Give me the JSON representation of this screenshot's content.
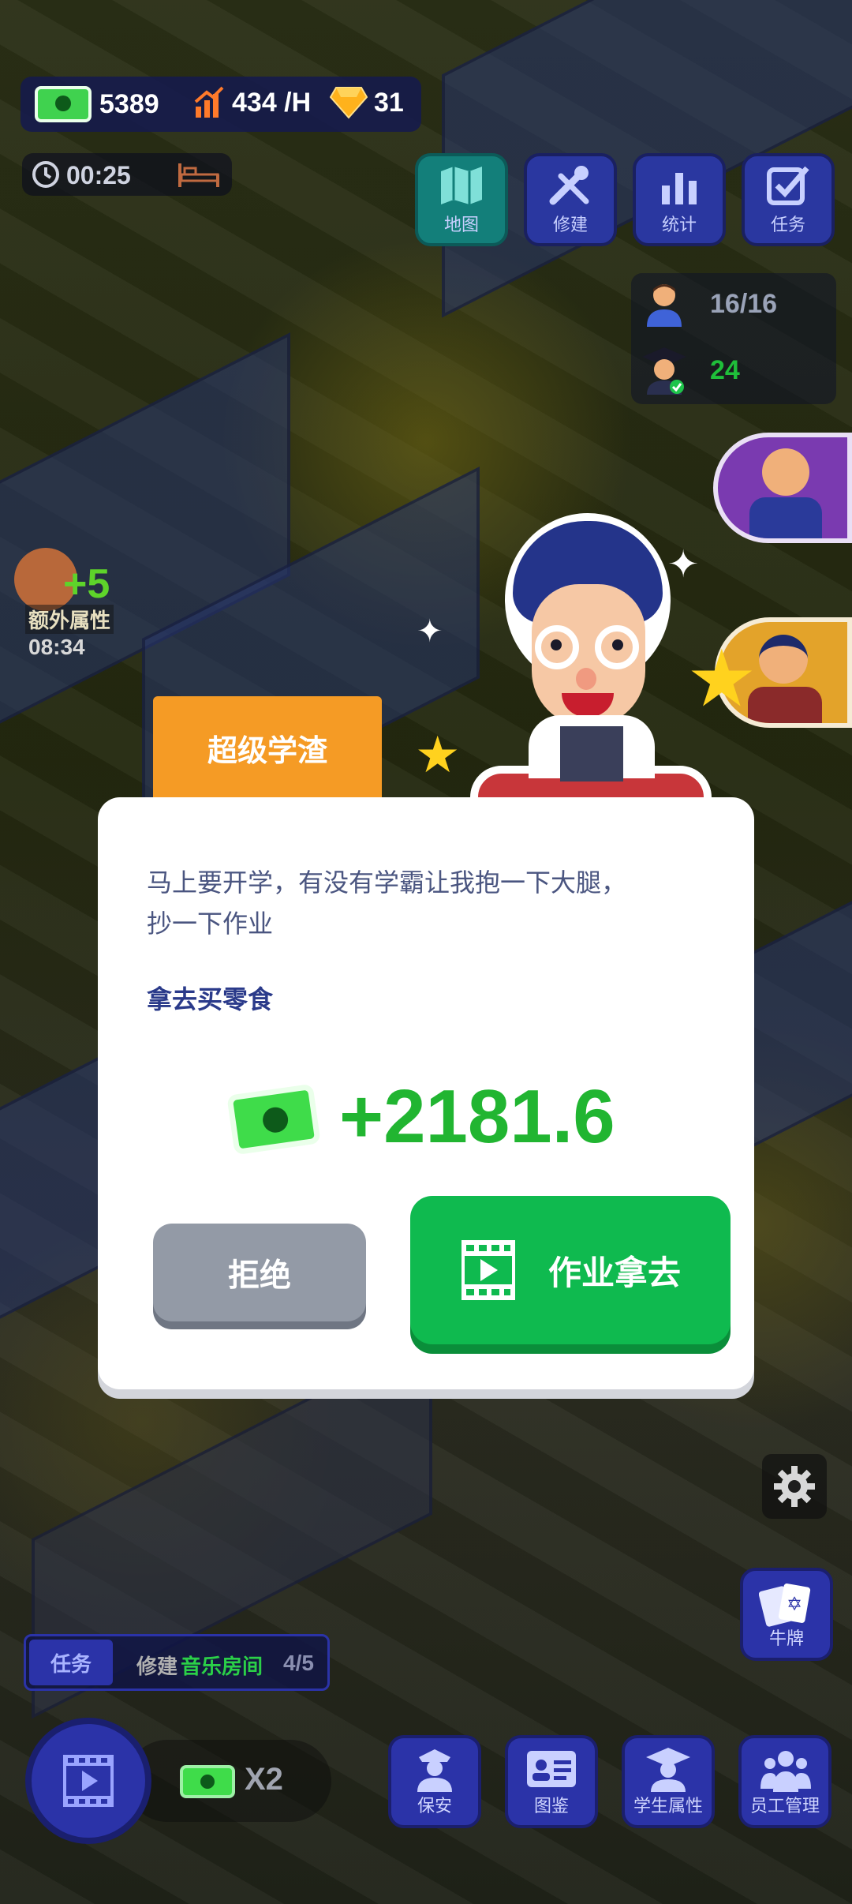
{
  "currency": {
    "cash": "5389",
    "income": "434 /H",
    "gems": "31"
  },
  "timer": "00:25",
  "top_menu": [
    {
      "label": "地图",
      "icon": "map-icon"
    },
    {
      "label": "修建",
      "icon": "tools-icon"
    },
    {
      "label": "统计",
      "icon": "bar-chart-icon"
    },
    {
      "label": "任务",
      "icon": "checkbox-icon"
    }
  ],
  "population": {
    "students": "16/16",
    "graduates": "24"
  },
  "bonus": {
    "value": "+5",
    "label": "额外属性",
    "timer": "08:34"
  },
  "dialog": {
    "title": "超级学渣",
    "message_line1": "马上要开学，有没有学霸让我抱一下大腿，",
    "message_line2": "抄一下作业",
    "action_text": "拿去买零食",
    "reward": "+2181.6",
    "reject_label": "拒绝",
    "accept_label": "作业拿去"
  },
  "task_bar": {
    "label": "任务",
    "text": "修建",
    "highlight": "音乐房间",
    "progress": "4/5"
  },
  "ad_boost": {
    "multiplier": "X2"
  },
  "side_menu": {
    "cards_label": "牛牌"
  },
  "bottom_menu": [
    {
      "label": "保安",
      "icon": "security-guard-icon"
    },
    {
      "label": "图鉴",
      "icon": "id-card-icon"
    },
    {
      "label": "学生属性",
      "icon": "graduate-icon"
    },
    {
      "label": "员工管理",
      "icon": "staff-icon"
    }
  ],
  "colors": {
    "accent_green": "#21b531",
    "tab_orange": "#f59b25",
    "hud_blue": "#2a37a0"
  }
}
